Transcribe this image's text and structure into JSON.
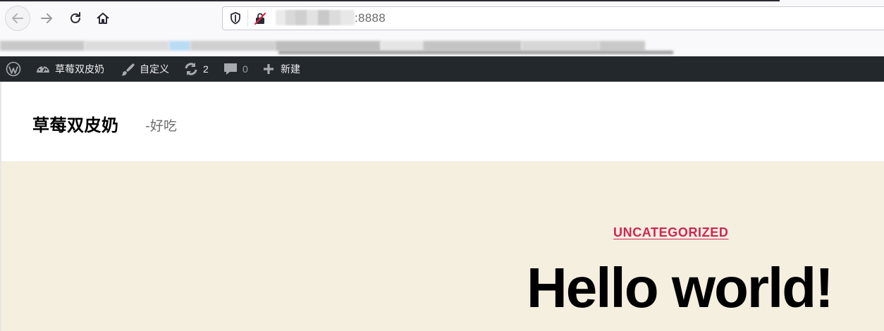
{
  "browser": {
    "url_suffix": ":8888",
    "icons": {
      "back": "back-arrow-icon",
      "forward": "forward-arrow-icon",
      "reload": "reload-icon",
      "home": "home-icon",
      "shield": "tracking-shield-icon",
      "insecure": "insecure-lock-icon"
    }
  },
  "admin_bar": {
    "site_name": "草莓双皮奶",
    "customize": "自定义",
    "updates_count": "2",
    "comments_count": "0",
    "new_label": "新建"
  },
  "site": {
    "title": "草莓双皮奶",
    "description": "-好吃"
  },
  "post": {
    "category": "UNCATEGORIZED",
    "title": "Hello world!"
  },
  "colors": {
    "admin_bar_bg": "#23282d",
    "accent": "#cd2653",
    "hero_bg": "#f5efe0"
  }
}
